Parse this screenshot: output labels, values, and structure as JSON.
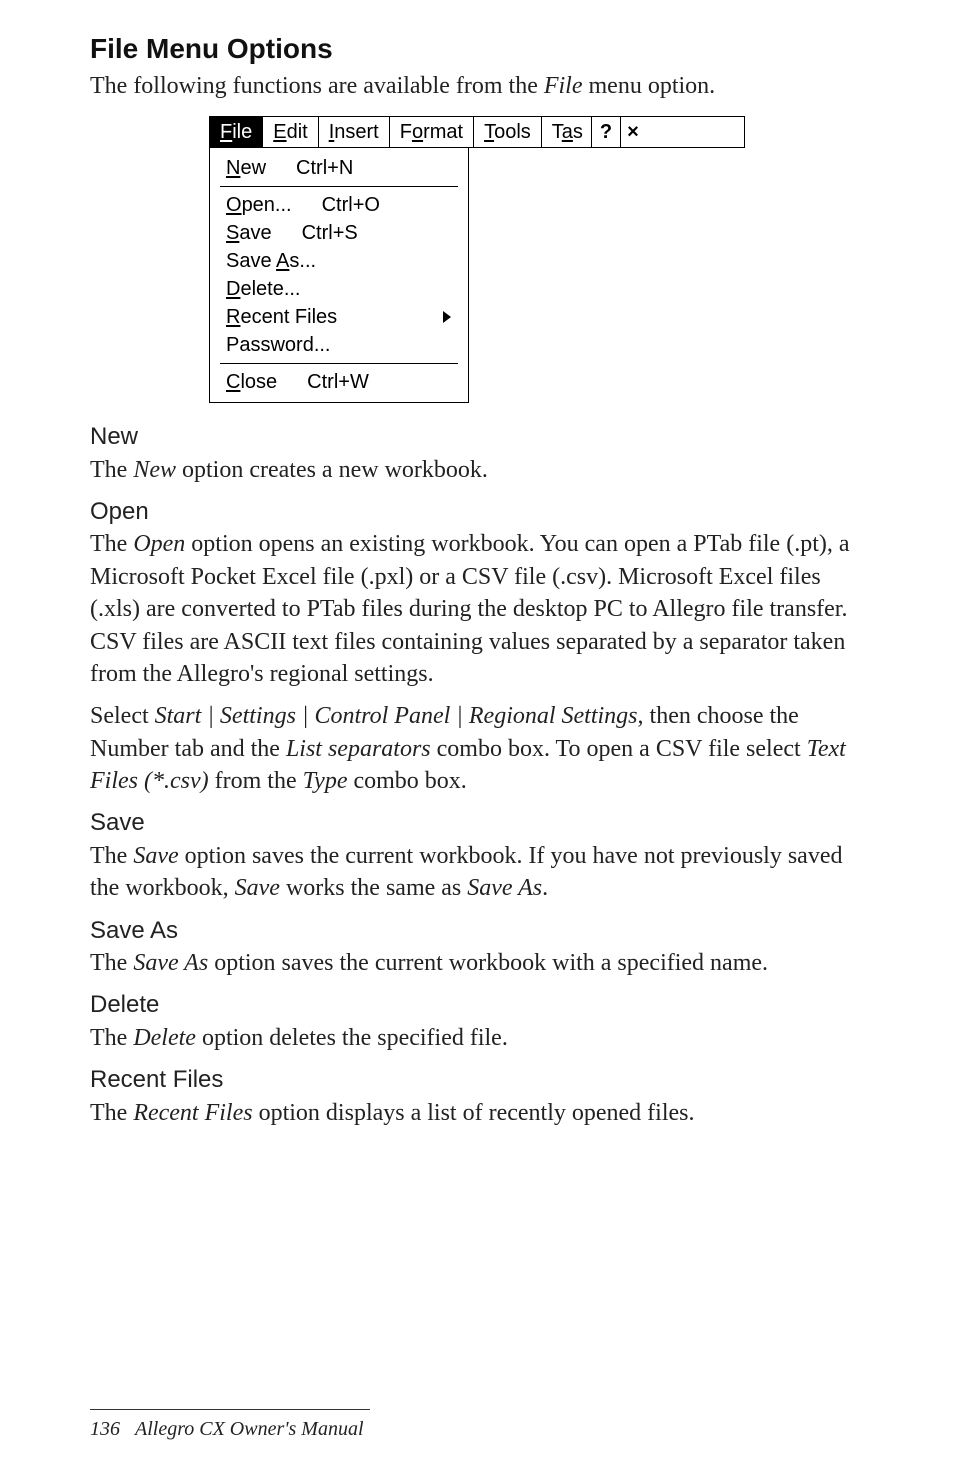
{
  "page": {
    "title": "File Menu Options",
    "intro_a": "The following functions are available from the ",
    "intro_file": "File",
    "intro_b": " menu option."
  },
  "menubar": {
    "file_pre_u": "F",
    "file_post": "ile",
    "edit_pre_u": "E",
    "edit_post": "dit",
    "insert_pre_u": "I",
    "insert_post": "nsert",
    "format_pre": "F",
    "format_u": "o",
    "format_post": "rmat",
    "tools_pre_u": "T",
    "tools_post": "ools",
    "task_pre": "T",
    "task_u": "a",
    "task_post": "s",
    "help": "?",
    "close": "×"
  },
  "dropdown": {
    "new_pre": "",
    "new_u": "N",
    "new_post": "ew",
    "new_sc": "Ctrl+N",
    "open_pre": "",
    "open_u": "O",
    "open_post": "pen...",
    "open_sc": "Ctrl+O",
    "save_pre": "",
    "save_u": "S",
    "save_post": "ave",
    "save_sc": "Ctrl+S",
    "saveas_pre": "Save ",
    "saveas_u": "A",
    "saveas_post": "s...",
    "delete_pre": "",
    "delete_u": "D",
    "delete_post": "elete...",
    "recent_pre": "",
    "recent_u": "R",
    "recent_post": "ecent Files",
    "password": "Password...",
    "close_pre": "",
    "close_u": "C",
    "close_post": "lose",
    "close_sc": "Ctrl+W"
  },
  "sections": {
    "new_h": "New",
    "new_a": "The ",
    "new_i": "New",
    "new_b": " option creates a new workbook.",
    "open_h": "Open",
    "open_a": "The ",
    "open_i": "Open",
    "open_b": " option opens an existing workbook. You can open a PTab file (.pt), a Microsoft Pocket Excel file (.pxl) or a CSV file (.csv). Microsoft Excel files (.xls) are converted to PTab files during the desktop PC to Allegro file transfer. CSV files are ASCII text files containing values separated by a separator taken from the Allegro's regional settings.",
    "open2_a": "Select ",
    "open2_i1": "Start | Settings | Control Panel | Regional Settings",
    "open2_b": ", then choose the Number tab and the ",
    "open2_i2": "List separators",
    "open2_c": " combo box. To open a CSV file select ",
    "open2_i3": "Text Files (*.csv)",
    "open2_d": " from the  ",
    "open2_i4": "Type",
    "open2_e": " combo box.",
    "save_h": "Save",
    "save_a": "The ",
    "save_i1": "Save",
    "save_b": " option saves the current workbook. If you have not previously saved the workbook, ",
    "save_i2": "Save",
    "save_c": " works the same as ",
    "save_i3": "Save As",
    "save_d": ".",
    "saveas_h": "Save As",
    "saveas_a": "The ",
    "saveas_i": "Save As",
    "saveas_b": " option saves the current workbook with a specified name.",
    "delete_h": "Delete",
    "delete_a": "The ",
    "delete_i": "Delete",
    "delete_b": " option deletes the specified file.",
    "recent_h": "Recent Files",
    "recent_a": "The ",
    "recent_i": "Recent Files",
    "recent_b": " option displays a list of recently opened files."
  },
  "footer": {
    "page_num": "136",
    "book": "Allegro CX Owner's Manual"
  }
}
